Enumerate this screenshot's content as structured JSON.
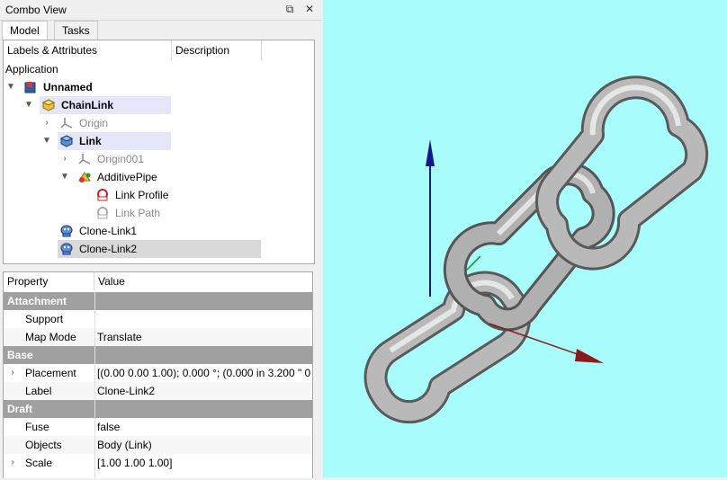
{
  "window": {
    "title": "Combo View",
    "float_btn": "⧉",
    "close_btn": "✕"
  },
  "tabs": [
    {
      "label": "Model"
    },
    {
      "label": "Tasks"
    }
  ],
  "tree": {
    "col_labels": "Labels & Attributes",
    "col_desc": "Description",
    "root_label": "Application",
    "items": [
      {
        "label": "Unnamed"
      },
      {
        "label": "ChainLink"
      },
      {
        "label": "Origin"
      },
      {
        "label": "Link"
      },
      {
        "label": "Origin001"
      },
      {
        "label": "AdditivePipe"
      },
      {
        "label": "Link Profile"
      },
      {
        "label": "Link Path"
      },
      {
        "label": "Clone-Link1"
      },
      {
        "label": "Clone-Link2"
      }
    ]
  },
  "props": {
    "col_property": "Property",
    "col_value": "Value",
    "groups": {
      "attachment": "Attachment",
      "base": "Base",
      "draft": "Draft"
    },
    "rows": {
      "support": {
        "k": "Support",
        "v": ""
      },
      "map_mode": {
        "k": "Map Mode",
        "v": "Translate"
      },
      "placement": {
        "k": "Placement",
        "v": "[(0.00 0.00 1.00); 0.000 °; (0.000 in  3.200 \"  0..."
      },
      "label": {
        "k": "Label",
        "v": "Clone-Link2"
      },
      "fuse": {
        "k": "Fuse",
        "v": "false"
      },
      "objects": {
        "k": "Objects",
        "v": "Body (Link)"
      },
      "scale": {
        "k": "Scale",
        "v": "[1.00 1.00 1.00]"
      }
    }
  },
  "viewport": {
    "background": "#a9fcfc",
    "axis_z_color": "#16168a",
    "axis_x_color": "#8b1a1a",
    "axis_y_color": "#1a8b1a"
  }
}
